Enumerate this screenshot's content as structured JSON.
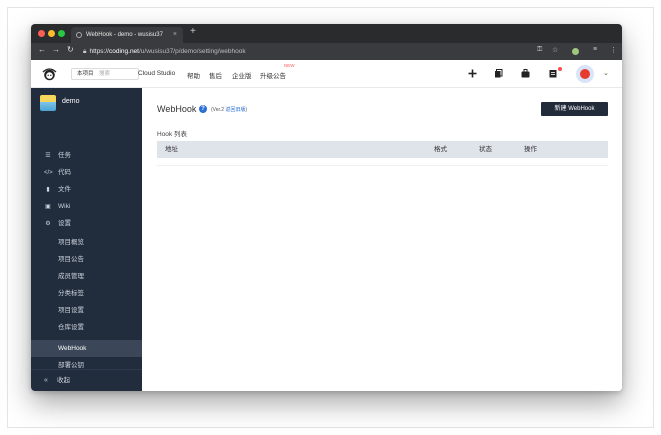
{
  "browser": {
    "tab_title": "WebHook - demo - wusisu37",
    "tab_close": "×",
    "new_tab": "+",
    "url_scheme": "https://",
    "url_host": "coding.net",
    "url_path": "/u/wusisu37/p/demo/setting/webhook",
    "icons": [
      "back-icon",
      "forward-icon",
      "reload-icon",
      "lock-icon",
      "key-icon",
      "star-icon",
      "extension-icon",
      "menu-icon"
    ]
  },
  "header": {
    "project_pill": {
      "name": "本项目",
      "search_placeholder": "搜索"
    },
    "nav": [
      "Cloud Studio",
      "帮助",
      "售后",
      "企业版",
      "升级公告"
    ],
    "new_badge": "NEW",
    "avatar_caret": "⌄"
  },
  "sidebar": {
    "project_name": "demo",
    "items": [
      {
        "icon": "task-icon",
        "label": "任务"
      },
      {
        "icon": "code-icon",
        "label": "代码"
      },
      {
        "icon": "file-icon",
        "label": "文件"
      },
      {
        "icon": "wiki-icon",
        "label": "Wiki"
      },
      {
        "icon": "settings-icon",
        "label": "设置"
      }
    ],
    "sub_items": [
      {
        "label": "项目概览"
      },
      {
        "label": "项目公告"
      },
      {
        "label": "成员管理"
      },
      {
        "label": "分类标签"
      },
      {
        "label": "项目设置"
      },
      {
        "label": "仓库设置"
      },
      {
        "label": "WebHook"
      },
      {
        "label": "部署公钥"
      }
    ],
    "active_sub": "WebHook",
    "collapse_label": "收起"
  },
  "main": {
    "title": "WebHook",
    "version_prefix": "(Ver.2 ",
    "version_link": "返回旧版",
    "version_suffix": ")",
    "new_button": "新建 WebHook",
    "list_label": "Hook 列表",
    "columns": [
      "地址",
      "格式",
      "状态",
      "操作"
    ]
  },
  "colors": {
    "sidebar_bg": "#212c3d",
    "sidebar_active": "#3b4758",
    "primary_button": "#222b3a",
    "table_header": "#dfe3ea",
    "link": "#2a6fd6"
  }
}
